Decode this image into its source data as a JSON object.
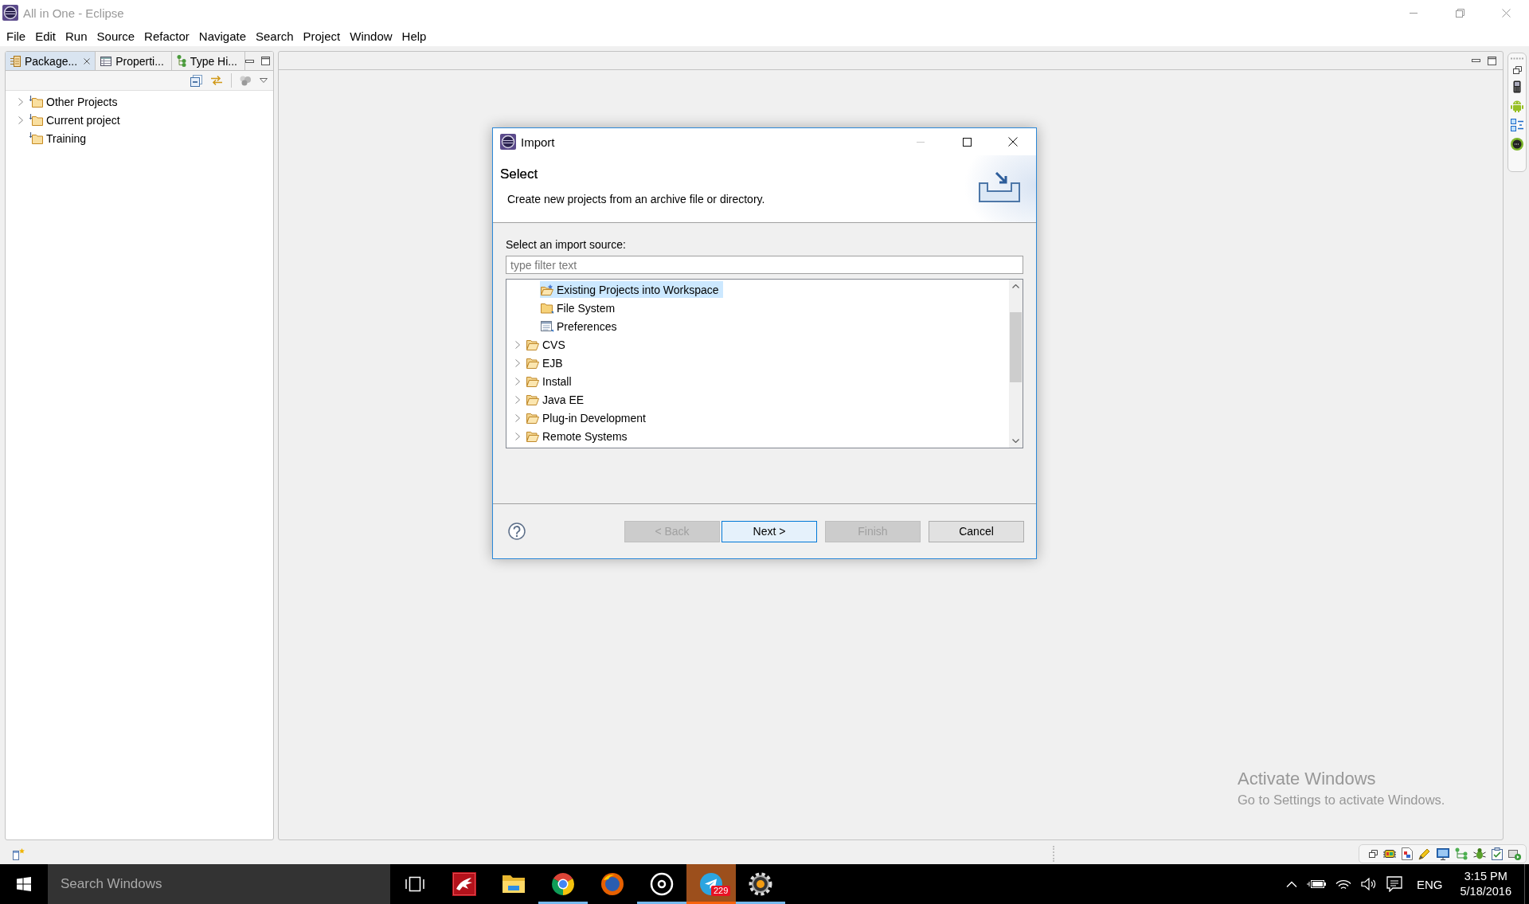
{
  "window": {
    "title": "All in One - Eclipse"
  },
  "menu": [
    "File",
    "Edit",
    "Run",
    "Source",
    "Refactor",
    "Navigate",
    "Search",
    "Project",
    "Window",
    "Help"
  ],
  "package_view": {
    "tabs": [
      {
        "label": "Package...",
        "selected": true
      },
      {
        "label": "Properti...",
        "selected": false
      },
      {
        "label": "Type Hi...",
        "selected": false
      }
    ],
    "tree": [
      {
        "label": "Other Projects",
        "expanded": false,
        "selected": false
      },
      {
        "label": "Current project",
        "expanded": false,
        "selected": false
      },
      {
        "label": "Training",
        "selected": false
      }
    ]
  },
  "import_dialog": {
    "title": "Import",
    "heading": "Select",
    "description": "Create new projects from an archive file or directory.",
    "source_label": "Select an import source:",
    "filter": {
      "placeholder": "type filter text"
    },
    "sources": [
      {
        "children": [
          {
            "label": "Existing Projects into Workspace",
            "kind": "project",
            "selected": true
          },
          {
            "label": "File System",
            "kind": "filesystem",
            "selected": false
          },
          {
            "label": "Preferences",
            "kind": "preferences",
            "selected": false
          }
        ]
      },
      {
        "label": "CVS",
        "kind": "category",
        "expanded": false,
        "selected": false
      },
      {
        "label": "EJB",
        "kind": "category",
        "expanded": false,
        "selected": false
      },
      {
        "label": "Install",
        "kind": "category",
        "expanded": false,
        "selected": false
      },
      {
        "label": "Java EE",
        "kind": "category",
        "expanded": false,
        "selected": false
      },
      {
        "label": "Plug-in Development",
        "kind": "category",
        "expanded": false,
        "selected": false
      },
      {
        "label": "Remote Systems",
        "kind": "category",
        "expanded": false,
        "selected": false
      }
    ],
    "buttons": [
      {
        "label": "< Back",
        "disabled": true,
        "default": false
      },
      {
        "label": "Next >",
        "disabled": false,
        "default": true
      },
      {
        "label": "Finish",
        "disabled": true,
        "default": false
      },
      {
        "label": "Cancel",
        "disabled": false,
        "default": false
      }
    ]
  },
  "activation_notice": {
    "title": "Activate Windows",
    "message": "Go to Settings to activate Windows."
  },
  "taskbar": {
    "search": {
      "placeholder": "Search Windows"
    },
    "apps": [
      {
        "running": false,
        "attention": false
      },
      {
        "running": false,
        "attention": false
      },
      {
        "running": true,
        "attention": false
      },
      {
        "running": false,
        "attention": false
      },
      {
        "running": true,
        "attention": false
      },
      {
        "running": true,
        "attention": true,
        "badge": "229"
      },
      {
        "running": true,
        "attention": false
      }
    ],
    "language": "ENG",
    "clock": {
      "time": "3:15 PM",
      "date": "5/18/2016"
    }
  }
}
